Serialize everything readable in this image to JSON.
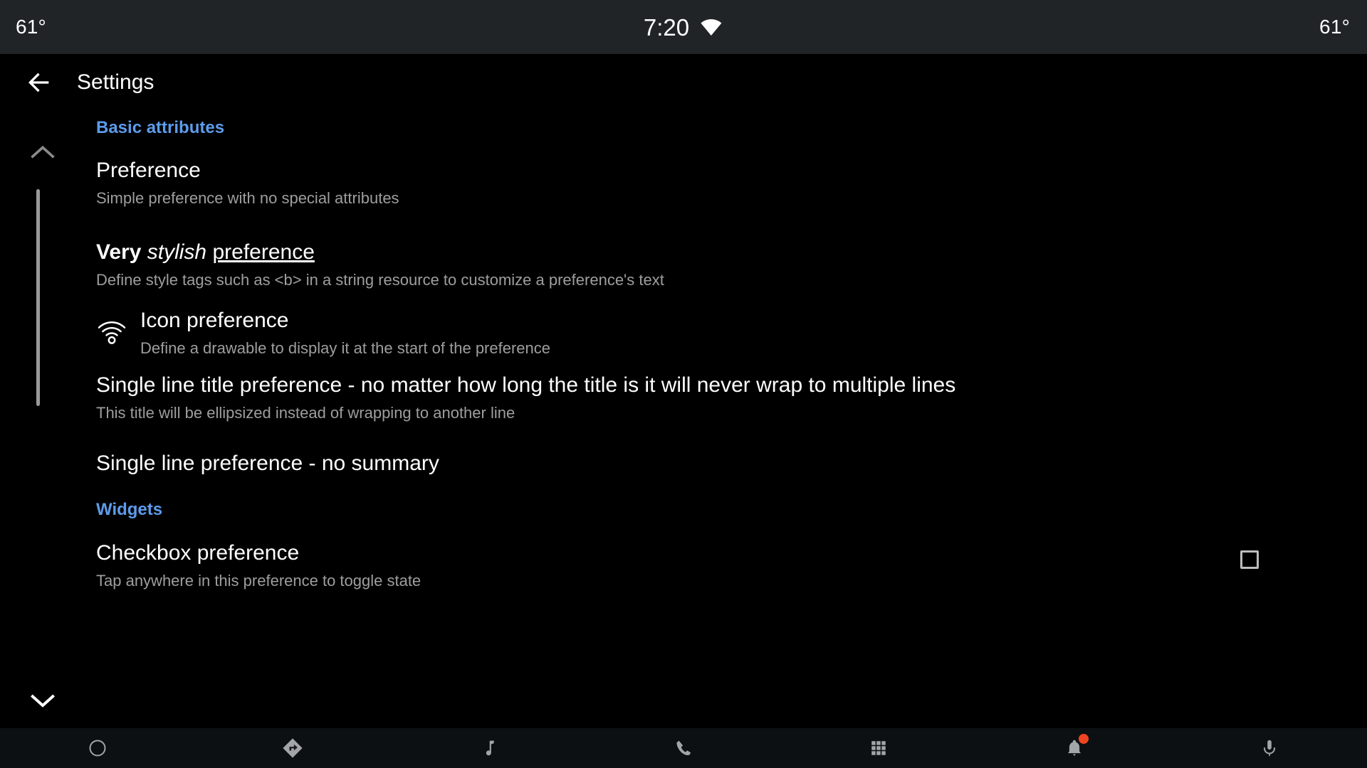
{
  "status_bar": {
    "temp_left": "61°",
    "clock": "7:20",
    "temp_right": "61°",
    "wifi_icon": "wifi-icon",
    "background_color": "#212427"
  },
  "toolbar": {
    "back_icon": "arrow-back-icon",
    "title": "Settings"
  },
  "colors": {
    "accent_blue": "#5d9cec",
    "title_text": "#ffffff",
    "summary_text": "#9e9e9e",
    "background": "#000000",
    "notification_badge": "#ee4422"
  },
  "content": {
    "scroll_up_icon": "chevron-up-icon",
    "scroll_down_icon": "chevron-down-icon",
    "sections": [
      {
        "header": "Basic attributes",
        "preferences": [
          {
            "title": "Preference",
            "summary": "Simple preference with no special attributes"
          },
          {
            "title_plain": "Very stylish preference",
            "title_bold": "Very",
            "title_italic": "stylish",
            "title_underline": "preference",
            "summary": "Define style tags such as <b> in a string resource to customize a preference's text"
          },
          {
            "icon": "wifi-icon",
            "title": "Icon preference",
            "summary": "Define a drawable to display it at the start of the preference"
          },
          {
            "title": "Single line title preference - no matter how long the title is it will never wrap to multiple lines",
            "summary": "This title will be ellipsized instead of wrapping to another line"
          },
          {
            "title": "Single line preference - no summary",
            "summary": ""
          }
        ]
      },
      {
        "header": "Widgets",
        "preferences": [
          {
            "title": "Checkbox preference",
            "summary": "Tap anywhere in this preference to toggle state",
            "widget": "checkbox",
            "checked": false
          }
        ]
      }
    ]
  },
  "bottom_nav": {
    "items": [
      {
        "icon": "home-circle-icon",
        "badge": false
      },
      {
        "icon": "navigation-directions-icon",
        "badge": false
      },
      {
        "icon": "music-note-icon",
        "badge": false
      },
      {
        "icon": "phone-icon",
        "badge": false
      },
      {
        "icon": "apps-grid-icon",
        "badge": false
      },
      {
        "icon": "notification-bell-icon",
        "badge": true
      },
      {
        "icon": "microphone-icon",
        "badge": false
      }
    ]
  }
}
